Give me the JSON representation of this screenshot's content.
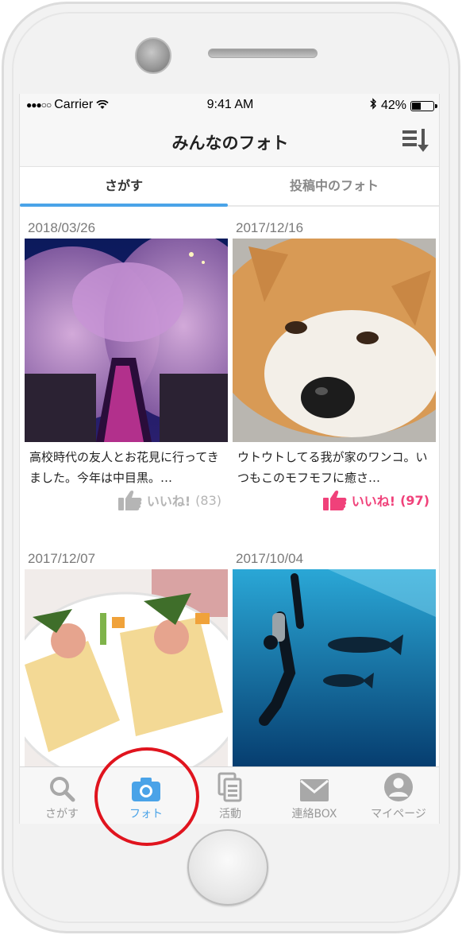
{
  "status_bar": {
    "carrier": "Carrier",
    "signal": "●●●○○",
    "time": "9:41 AM",
    "battery_text": "42%",
    "battery_level": 0.42
  },
  "nav": {
    "title": "みんなのフォト"
  },
  "tabs": [
    {
      "label": "さがす",
      "active": true
    },
    {
      "label": "投稿中のフォト",
      "active": false
    }
  ],
  "posts": [
    {
      "date": "2018/03/26",
      "caption": "高校時代の友人とお花見に行ってきました。今年は中目黒。…",
      "like_label": "いいね!",
      "like_count": "(83)",
      "liked": false,
      "photo": "cherry-blossoms-river-icon"
    },
    {
      "date": "2017/12/16",
      "caption": "ウトウトしてる我が家のワンコ。いつもこのモフモフに癒さ…",
      "like_label": "いいね!",
      "like_count": "(97)",
      "liked": true,
      "photo": "akita-dog-icon"
    },
    {
      "date": "2017/12/07",
      "caption": "",
      "photo": "crepe-plate-icon"
    },
    {
      "date": "2017/10/04",
      "caption": "",
      "photo": "scuba-diver-icon"
    }
  ],
  "bottom_tabs": [
    {
      "label": "さがす",
      "icon": "search-icon",
      "active": false
    },
    {
      "label": "フォト",
      "icon": "camera-icon",
      "active": true
    },
    {
      "label": "活動",
      "icon": "documents-icon",
      "active": false
    },
    {
      "label": "連絡BOX",
      "icon": "mail-icon",
      "active": false
    },
    {
      "label": "マイページ",
      "icon": "user-icon",
      "active": false
    }
  ],
  "colors": {
    "accent": "#4aa3e8",
    "liked": "#f0417a",
    "unliked": "#b5b5b5",
    "annotation": "#e0141e"
  }
}
